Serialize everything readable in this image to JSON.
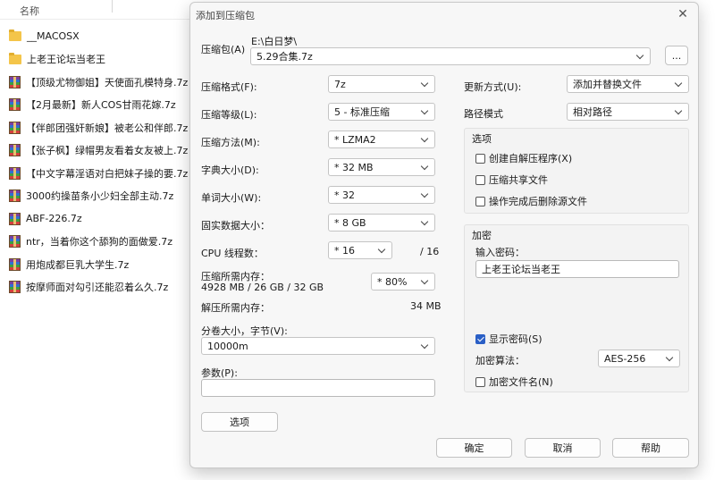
{
  "explorer": {
    "column_name": "名称",
    "files": [
      {
        "name": "__MACOSX",
        "icon": "folder-icon"
      },
      {
        "name": "上老王论坛当老王",
        "icon": "folder-icon"
      },
      {
        "name": "【顶级尤物御姐】天使面孔模特身.7z",
        "icon": "archive-icon"
      },
      {
        "name": "【2月最新】新人COS甘雨花嫁.7z",
        "icon": "archive-icon"
      },
      {
        "name": "【伴郎团强奸新娘】被老公和伴郎.7z",
        "icon": "archive-icon"
      },
      {
        "name": "【张子枫】绿帽男友看着女友被上.7z",
        "icon": "archive-icon"
      },
      {
        "name": "【中文字幕淫语对白把妹子操的要.7z",
        "icon": "archive-icon"
      },
      {
        "name": "3000约操苗条小少妇全部主动.7z",
        "icon": "archive-icon"
      },
      {
        "name": "ABF-226.7z",
        "icon": "archive-icon"
      },
      {
        "name": "ntr，当着你这个舔狗的面做爱.7z",
        "icon": "archive-icon"
      },
      {
        "name": "用炮成都巨乳大学生.7z",
        "icon": "archive-icon"
      },
      {
        "name": "按摩师面对勾引还能忍着么久.7z",
        "icon": "archive-icon"
      }
    ]
  },
  "dialog": {
    "title": "添加到压缩包",
    "close_symbol": "✕",
    "archive": {
      "label": "压缩包(A)",
      "path": "E:\\白日梦\\",
      "name": "5.29合集.7z",
      "browse": "..."
    },
    "left": {
      "format": {
        "label": "压缩格式(F):",
        "value": "7z"
      },
      "level": {
        "label": "压缩等级(L):",
        "value": "5 - 标准压缩"
      },
      "method": {
        "label": "压缩方法(M):",
        "value": "* LZMA2"
      },
      "dict": {
        "label": "字典大小(D):",
        "value": "* 32 MB"
      },
      "word": {
        "label": "单词大小(W):",
        "value": "* 32"
      },
      "solid": {
        "label": "固实数据大小：",
        "value": "* 8 GB"
      },
      "threads": {
        "label": "CPU 线程数：",
        "value": "* 16",
        "max": "/ 16"
      },
      "mem_compress": {
        "label": "压缩所需内存：",
        "detail": "4928 MB / 26 GB / 32 GB",
        "value": "* 80%"
      },
      "mem_decompress": {
        "label": "解压所需内存：",
        "value": "34 MB"
      },
      "split": {
        "label": "分卷大小，字节(V):",
        "value": "10000m"
      },
      "params": {
        "label": "参数(P):",
        "value": ""
      },
      "options_button": "选项"
    },
    "right": {
      "update": {
        "label": "更新方式(U):",
        "value": "添加并替换文件"
      },
      "path_mode": {
        "label": "路径模式",
        "value": "相对路径"
      },
      "options": {
        "title": "选项",
        "sfx": {
          "label": "创建自解压程序(X)",
          "checked": false
        },
        "shared": {
          "label": "压缩共享文件",
          "checked": false
        },
        "delete": {
          "label": "操作完成后删除源文件",
          "checked": false
        }
      },
      "encryption": {
        "title": "加密",
        "password_label": "输入密码：",
        "password": "上老王论坛当老王",
        "show_password": {
          "label": "显示密码(S)",
          "checked": true
        },
        "method_label": "加密算法：",
        "method": "AES-256",
        "encrypt_names": {
          "label": "加密文件名(N)",
          "checked": false
        }
      }
    },
    "buttons": {
      "ok": "确定",
      "cancel": "取消",
      "help": "帮助"
    }
  }
}
